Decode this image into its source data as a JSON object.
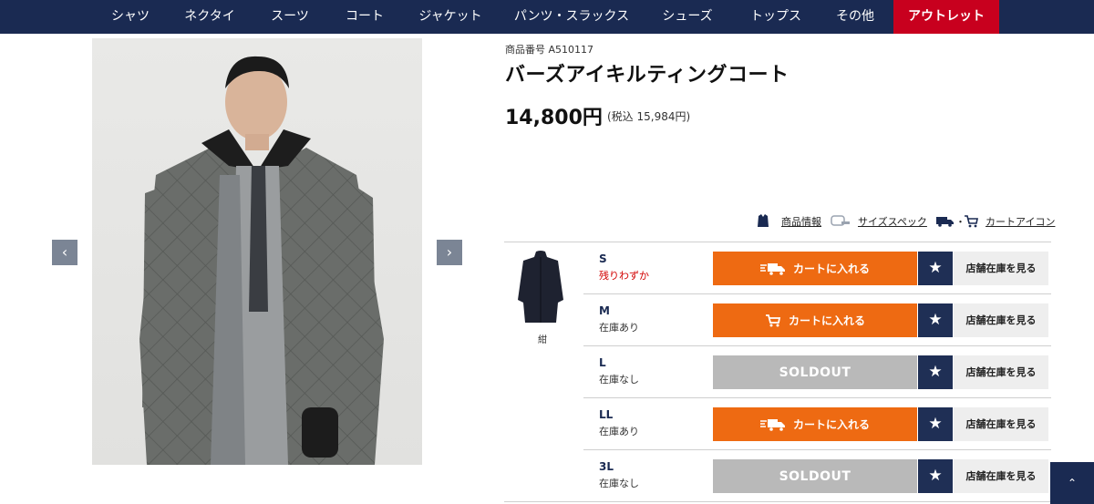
{
  "nav": {
    "items": [
      "シャツ",
      "ネクタイ",
      "スーツ",
      "コート",
      "ジャケット",
      "パンツ・スラックス",
      "シューズ",
      "トップス",
      "その他",
      "アウトレット"
    ]
  },
  "product": {
    "number_label": "商品番号 A510117",
    "title": "バーズアイキルティングコート",
    "price": "14,800円",
    "tax": "(税込 15,984円)",
    "color": "紺"
  },
  "legend": {
    "info": "商品情報",
    "spec": "サイズスペック",
    "cart_icon": "カートアイコン",
    "separator": "・"
  },
  "labels": {
    "add_to_cart": "カートに入れる",
    "soldout": "SOLDOUT",
    "store_stock": "店舗在庫を見る"
  },
  "sizes": [
    {
      "size": "S",
      "stock": "残りわずか",
      "status": "low",
      "cart_icon": "truck-icon"
    },
    {
      "size": "M",
      "stock": "在庫あり",
      "status": "in",
      "cart_icon": "cart-icon"
    },
    {
      "size": "L",
      "stock": "在庫なし",
      "status": "sold",
      "cart_icon": ""
    },
    {
      "size": "LL",
      "stock": "在庫あり",
      "status": "in",
      "cart_icon": "truck-icon"
    },
    {
      "size": "3L",
      "stock": "在庫なし",
      "status": "sold",
      "cart_icon": ""
    }
  ],
  "colors": {
    "navy": "#1a2a52",
    "outlet": "#c8001e",
    "cart_orange": "#ee6a12",
    "sold_gray": "#b9b9b9"
  }
}
